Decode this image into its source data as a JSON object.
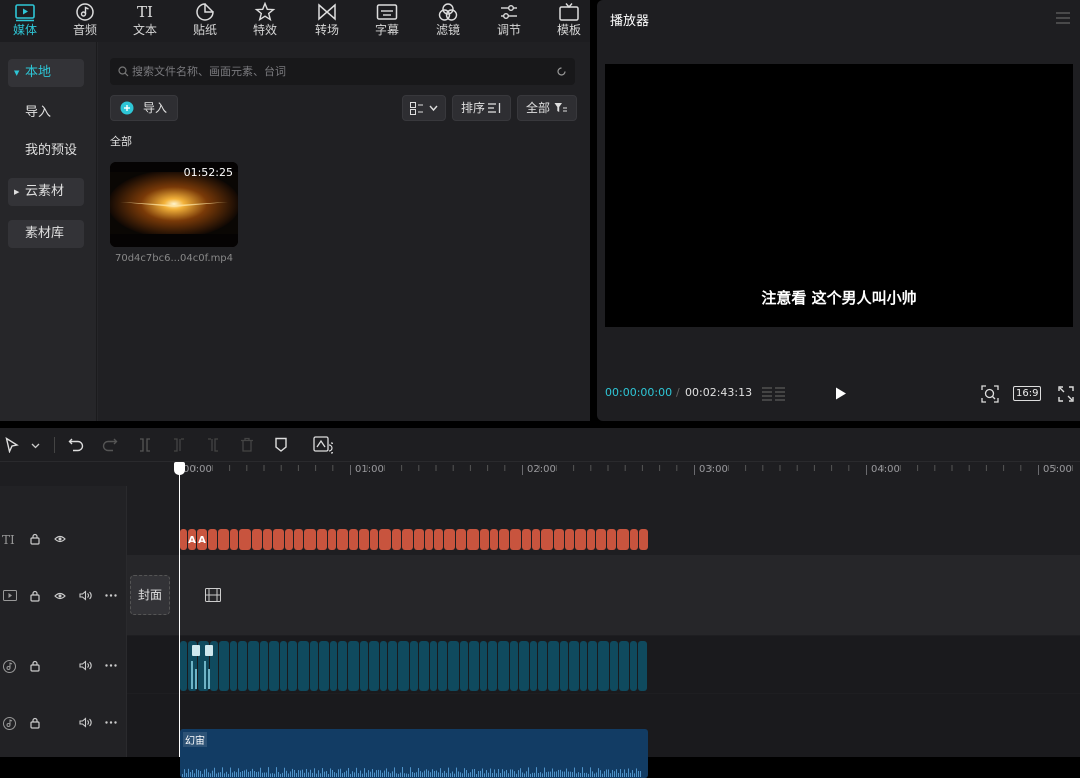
{
  "toolbar": {
    "tabs": [
      {
        "label": "媒体",
        "icon": "media-icon",
        "active": true
      },
      {
        "label": "音频",
        "icon": "audio-icon"
      },
      {
        "label": "文本",
        "icon": "text-icon"
      },
      {
        "label": "贴纸",
        "icon": "sticker-icon"
      },
      {
        "label": "特效",
        "icon": "effects-icon"
      },
      {
        "label": "转场",
        "icon": "transition-icon"
      },
      {
        "label": "字幕",
        "icon": "caption-icon"
      },
      {
        "label": "滤镜",
        "icon": "filter-icon"
      },
      {
        "label": "调节",
        "icon": "adjust-icon"
      },
      {
        "label": "模板",
        "icon": "template-icon"
      }
    ],
    "accent": "#2ec6d6"
  },
  "sidebar": {
    "items": [
      {
        "label": "本地"
      },
      {
        "label": "导入"
      },
      {
        "label": "我的预设"
      },
      {
        "label": "云素材"
      },
      {
        "label": "素材库"
      }
    ]
  },
  "media": {
    "search_placeholder": "搜索文件名称、画面元素、台词",
    "import_label": "导入",
    "sort_label": "排序",
    "filter_label": "全部",
    "section_title": "全部",
    "items": [
      {
        "duration": "01:52:25",
        "filename": "70d4c7bc6...04c0f.mp4"
      }
    ]
  },
  "player": {
    "title": "播放器",
    "subtitle": "注意看 这个男人叫小帅",
    "current_time": "00:00:00:00",
    "separator": "/",
    "total_time": "00:02:43:13",
    "aspect_ratio": "16:9"
  },
  "timeline": {
    "ruler_labels": [
      "00:00",
      "01:00",
      "02:00",
      "03:00",
      "04:00",
      "05:00"
    ],
    "cover_label": "封面",
    "audio_clip_label": "幻宙",
    "text_clip_letter": "A"
  }
}
